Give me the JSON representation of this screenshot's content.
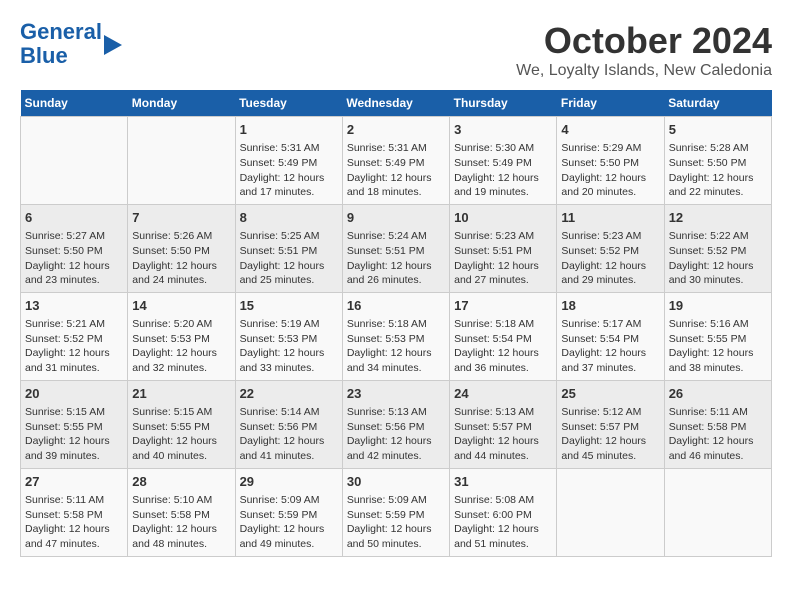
{
  "logo": {
    "line1": "General",
    "line2": "Blue"
  },
  "title": "October 2024",
  "subtitle": "We, Loyalty Islands, New Caledonia",
  "weekdays": [
    "Sunday",
    "Monday",
    "Tuesday",
    "Wednesday",
    "Thursday",
    "Friday",
    "Saturday"
  ],
  "weeks": [
    [
      {
        "day": "",
        "info": ""
      },
      {
        "day": "",
        "info": ""
      },
      {
        "day": "1",
        "info": "Sunrise: 5:31 AM\nSunset: 5:49 PM\nDaylight: 12 hours and 17 minutes."
      },
      {
        "day": "2",
        "info": "Sunrise: 5:31 AM\nSunset: 5:49 PM\nDaylight: 12 hours and 18 minutes."
      },
      {
        "day": "3",
        "info": "Sunrise: 5:30 AM\nSunset: 5:49 PM\nDaylight: 12 hours and 19 minutes."
      },
      {
        "day": "4",
        "info": "Sunrise: 5:29 AM\nSunset: 5:50 PM\nDaylight: 12 hours and 20 minutes."
      },
      {
        "day": "5",
        "info": "Sunrise: 5:28 AM\nSunset: 5:50 PM\nDaylight: 12 hours and 22 minutes."
      }
    ],
    [
      {
        "day": "6",
        "info": "Sunrise: 5:27 AM\nSunset: 5:50 PM\nDaylight: 12 hours and 23 minutes."
      },
      {
        "day": "7",
        "info": "Sunrise: 5:26 AM\nSunset: 5:50 PM\nDaylight: 12 hours and 24 minutes."
      },
      {
        "day": "8",
        "info": "Sunrise: 5:25 AM\nSunset: 5:51 PM\nDaylight: 12 hours and 25 minutes."
      },
      {
        "day": "9",
        "info": "Sunrise: 5:24 AM\nSunset: 5:51 PM\nDaylight: 12 hours and 26 minutes."
      },
      {
        "day": "10",
        "info": "Sunrise: 5:23 AM\nSunset: 5:51 PM\nDaylight: 12 hours and 27 minutes."
      },
      {
        "day": "11",
        "info": "Sunrise: 5:23 AM\nSunset: 5:52 PM\nDaylight: 12 hours and 29 minutes."
      },
      {
        "day": "12",
        "info": "Sunrise: 5:22 AM\nSunset: 5:52 PM\nDaylight: 12 hours and 30 minutes."
      }
    ],
    [
      {
        "day": "13",
        "info": "Sunrise: 5:21 AM\nSunset: 5:52 PM\nDaylight: 12 hours and 31 minutes."
      },
      {
        "day": "14",
        "info": "Sunrise: 5:20 AM\nSunset: 5:53 PM\nDaylight: 12 hours and 32 minutes."
      },
      {
        "day": "15",
        "info": "Sunrise: 5:19 AM\nSunset: 5:53 PM\nDaylight: 12 hours and 33 minutes."
      },
      {
        "day": "16",
        "info": "Sunrise: 5:18 AM\nSunset: 5:53 PM\nDaylight: 12 hours and 34 minutes."
      },
      {
        "day": "17",
        "info": "Sunrise: 5:18 AM\nSunset: 5:54 PM\nDaylight: 12 hours and 36 minutes."
      },
      {
        "day": "18",
        "info": "Sunrise: 5:17 AM\nSunset: 5:54 PM\nDaylight: 12 hours and 37 minutes."
      },
      {
        "day": "19",
        "info": "Sunrise: 5:16 AM\nSunset: 5:55 PM\nDaylight: 12 hours and 38 minutes."
      }
    ],
    [
      {
        "day": "20",
        "info": "Sunrise: 5:15 AM\nSunset: 5:55 PM\nDaylight: 12 hours and 39 minutes."
      },
      {
        "day": "21",
        "info": "Sunrise: 5:15 AM\nSunset: 5:55 PM\nDaylight: 12 hours and 40 minutes."
      },
      {
        "day": "22",
        "info": "Sunrise: 5:14 AM\nSunset: 5:56 PM\nDaylight: 12 hours and 41 minutes."
      },
      {
        "day": "23",
        "info": "Sunrise: 5:13 AM\nSunset: 5:56 PM\nDaylight: 12 hours and 42 minutes."
      },
      {
        "day": "24",
        "info": "Sunrise: 5:13 AM\nSunset: 5:57 PM\nDaylight: 12 hours and 44 minutes."
      },
      {
        "day": "25",
        "info": "Sunrise: 5:12 AM\nSunset: 5:57 PM\nDaylight: 12 hours and 45 minutes."
      },
      {
        "day": "26",
        "info": "Sunrise: 5:11 AM\nSunset: 5:58 PM\nDaylight: 12 hours and 46 minutes."
      }
    ],
    [
      {
        "day": "27",
        "info": "Sunrise: 5:11 AM\nSunset: 5:58 PM\nDaylight: 12 hours and 47 minutes."
      },
      {
        "day": "28",
        "info": "Sunrise: 5:10 AM\nSunset: 5:58 PM\nDaylight: 12 hours and 48 minutes."
      },
      {
        "day": "29",
        "info": "Sunrise: 5:09 AM\nSunset: 5:59 PM\nDaylight: 12 hours and 49 minutes."
      },
      {
        "day": "30",
        "info": "Sunrise: 5:09 AM\nSunset: 5:59 PM\nDaylight: 12 hours and 50 minutes."
      },
      {
        "day": "31",
        "info": "Sunrise: 5:08 AM\nSunset: 6:00 PM\nDaylight: 12 hours and 51 minutes."
      },
      {
        "day": "",
        "info": ""
      },
      {
        "day": "",
        "info": ""
      }
    ]
  ]
}
